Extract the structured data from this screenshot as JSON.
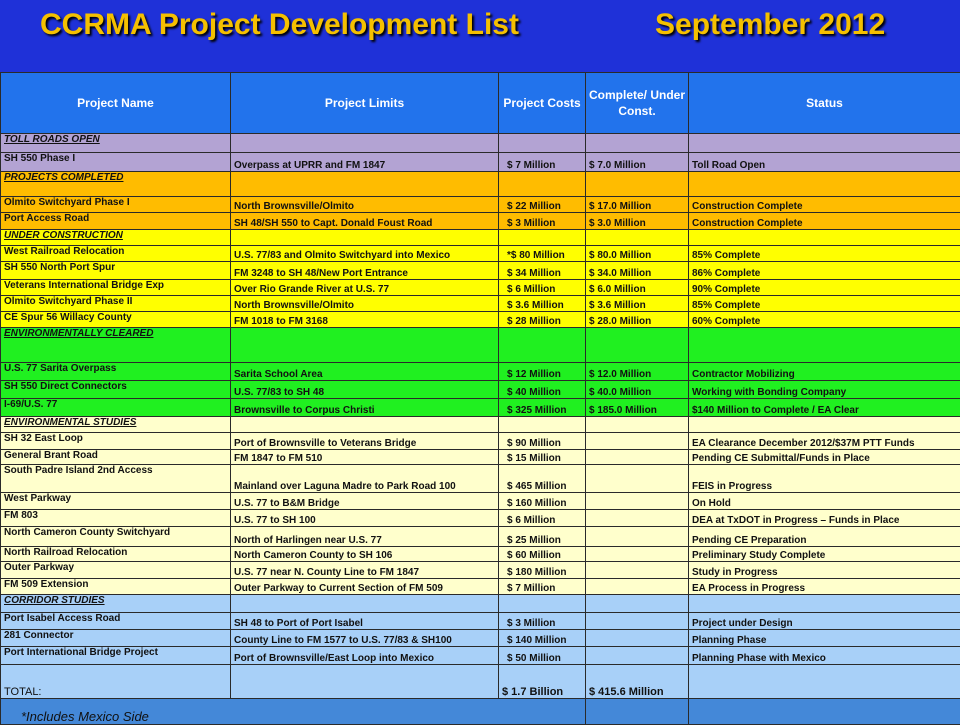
{
  "title": {
    "left": "CCRMA Project Development List",
    "right": "September 2012"
  },
  "headers": [
    "Project Name",
    "Project Limits",
    "Project Costs",
    "Complete/ Under Const.",
    "Status"
  ],
  "colors": {
    "toll": "#b3a3d3",
    "completed": "#ffbc00",
    "construction": "#ffff00",
    "cleared": "#20f020",
    "studies": "#ffffcc",
    "corridor": "#a8d0f8",
    "total": "#a8d0f8",
    "footer": "#4488d8",
    "header": "#2273ec"
  },
  "rows": [
    {
      "kind": "section",
      "color": "toll",
      "h": 19,
      "name": "TOLL ROADS OPEN"
    },
    {
      "kind": "data",
      "color": "toll",
      "h": 19,
      "name": "SH 550 Phase I",
      "limits": "Overpass at UPRR and FM 1847",
      "cost": "$      7 Million",
      "complete": "$    7.0 Million",
      "status": "Toll Road Open"
    },
    {
      "kind": "section",
      "color": "completed",
      "h": 25,
      "name": "PROJECTS COMPLETED"
    },
    {
      "kind": "data",
      "color": "completed",
      "h": 16,
      "name": "Olmito Switchyard Phase I",
      "limits": "North Brownsville/Olmito",
      "cost": "$    22 Million",
      "complete": "$   17.0 Million",
      "status": "Construction Complete"
    },
    {
      "kind": "data",
      "color": "completed",
      "h": 17,
      "name": "Port Access Road",
      "limits": "SH 48/SH 550 to Capt. Donald Foust Road",
      "cost": "$      3 Million",
      "complete": " $    3.0 Million",
      "status": "Construction Complete"
    },
    {
      "kind": "section",
      "color": "construction",
      "h": 16,
      "name": "UNDER CONSTRUCTION"
    },
    {
      "kind": "data",
      "color": "construction",
      "h": 16,
      "name": "West Railroad Relocation",
      "limits": "U.S. 77/83 and Olmito Switchyard into Mexico",
      "cost": "*$   80 Million",
      "complete": "$  80.0 Million",
      "status": "85% Complete"
    },
    {
      "kind": "data",
      "color": "construction",
      "h": 18,
      "name": "SH 550  North Port Spur",
      "limits": "FM 3248 to SH 48/New Port Entrance",
      "cost": "$    34 Million",
      "complete": "$  34.0 Million",
      "status": "86% Complete"
    },
    {
      "kind": "data",
      "color": "construction",
      "h": 16,
      "name": "Veterans International Bridge Exp",
      "limits": "Over Rio Grande River at U.S. 77",
      "cost": "$      6 Million",
      "complete": "$     6.0 Million",
      "status": "90% Complete"
    },
    {
      "kind": "data",
      "color": "construction",
      "h": 16,
      "name": "Olmito Switchyard Phase II",
      "limits": "North Brownsville/Olmito",
      "cost": "$  3.6 Million",
      "complete": "$     3.6 Million",
      "status": "85% Complete"
    },
    {
      "kind": "data",
      "color": "construction",
      "h": 16,
      "name": "CE Spur 56 Willacy County",
      "limits": "FM 1018 to FM 3168",
      "cost": "$    28 Million",
      "complete": "$  28.0 Million",
      "status": "60% Complete"
    },
    {
      "kind": "section",
      "color": "cleared",
      "h": 35,
      "name": "ENVIRONMENTALLY  CLEARED"
    },
    {
      "kind": "data",
      "color": "cleared",
      "h": 18,
      "name": "U.S. 77 Sarita Overpass",
      "limits": "Sarita School Area",
      "cost": "$    12 Million",
      "complete": "$   12.0 Million",
      "status": "Contractor Mobilizing"
    },
    {
      "kind": "data",
      "color": "cleared",
      "h": 18,
      "name": "SH 550  Direct Connectors",
      "limits": " U.S. 77/83 to SH 48",
      "cost": "$    40 Million",
      "complete": "$   40.0 Million",
      "status": "Working with Bonding Company"
    },
    {
      "kind": "data",
      "color": "cleared",
      "h": 18,
      "name": "I-69/U.S. 77",
      "limits": " Brownsville to Corpus Christi",
      "cost": "$  325 Million",
      "complete": " $ 185.0 Million",
      "status": "$140 Million  to Complete / EA Clear"
    },
    {
      "kind": "section",
      "color": "studies",
      "h": 16,
      "name": "ENVIRONMENTAL  STUDIES"
    },
    {
      "kind": "data",
      "color": "studies",
      "h": 17,
      "name": "SH 32 East Loop",
      "limits": "Port of Brownsville to Veterans Bridge",
      "cost": "$    90 Million",
      "complete": "",
      "status": "EA Clearance December 2012/$37M PTT Funds"
    },
    {
      "kind": "data",
      "color": "studies",
      "h": 15,
      "name": "General Brant Road",
      "limits": "FM 1847 to FM 510",
      "cost": "$    15 Million",
      "complete": "",
      "status": "Pending CE Submittal/Funds in Place"
    },
    {
      "kind": "data",
      "color": "studies",
      "h": 28,
      "name": "South Padre Island 2nd Access",
      "limits": "Mainland over Laguna Madre to Park Road 100",
      "cost": "$  465 Million",
      "complete": "",
      "status": "FEIS in Progress"
    },
    {
      "kind": "data",
      "color": "studies",
      "h": 17,
      "name": "West Parkway",
      "limits": "U.S. 77 to B&M Bridge",
      "cost": "$  160 Million",
      "complete": "",
      "status": "On Hold"
    },
    {
      "kind": "data",
      "color": "studies",
      "h": 17,
      "name": "FM 803",
      "limits": "U.S. 77 to SH 100",
      "cost": "$      6 Million",
      "complete": "",
      "status": "DEA at TxDOT in Progress – Funds in Place"
    },
    {
      "kind": "data",
      "color": "studies",
      "h": 20,
      "name": "North Cameron County  Switchyard",
      "limits": "North of Harlingen near U.S. 77",
      "cost": "$    25 Million",
      "complete": "",
      "status": "Pending CE Preparation"
    },
    {
      "kind": "data",
      "color": "studies",
      "h": 15,
      "name": "North Railroad Relocation",
      "limits": "North Cameron County to SH 106",
      "cost": "$    60 Million",
      "complete": "",
      "status": "Preliminary Study Complete"
    },
    {
      "kind": "data",
      "color": "studies",
      "h": 17,
      "name": "Outer Parkway",
      "limits": "U.S. 77 near N. County Line to FM 1847",
      "cost": "$  180 Million",
      "complete": "",
      "status": "Study in Progress"
    },
    {
      "kind": "data",
      "color": "studies",
      "h": 16,
      "name": "FM 509 Extension",
      "limits": "Outer Parkway to Current Section of FM 509",
      "cost": "$      7 Million",
      "complete": "",
      "status": "EA Process in Progress"
    },
    {
      "kind": "section",
      "color": "corridor",
      "h": 18,
      "name": "CORRIDOR  STUDIES"
    },
    {
      "kind": "data",
      "color": "corridor",
      "h": 17,
      "name": "Port Isabel Access Road",
      "limits": "SH 48 to Port of Port Isabel",
      "cost": "$      3 Million",
      "complete": "",
      "status": "Project under Design"
    },
    {
      "kind": "data",
      "color": "corridor",
      "h": 17,
      "name": "281 Connector",
      "limits": "County Line to FM 1577 to U.S. 77/83 & SH100",
      "cost": "$  140 Million",
      "complete": "",
      "status": "Planning Phase"
    },
    {
      "kind": "data",
      "color": "corridor",
      "h": 18,
      "name": "Port International Bridge Project",
      "limits": "Port of Brownsville/East Loop into Mexico",
      "cost": "$    50 Million",
      "complete": "",
      "status": "Planning Phase with Mexico"
    }
  ],
  "total": {
    "label": "TOTAL:",
    "cost": "$ 1.7 Billion",
    "complete": "$ 415.6 Million"
  },
  "footnote": "*Includes Mexico Side"
}
